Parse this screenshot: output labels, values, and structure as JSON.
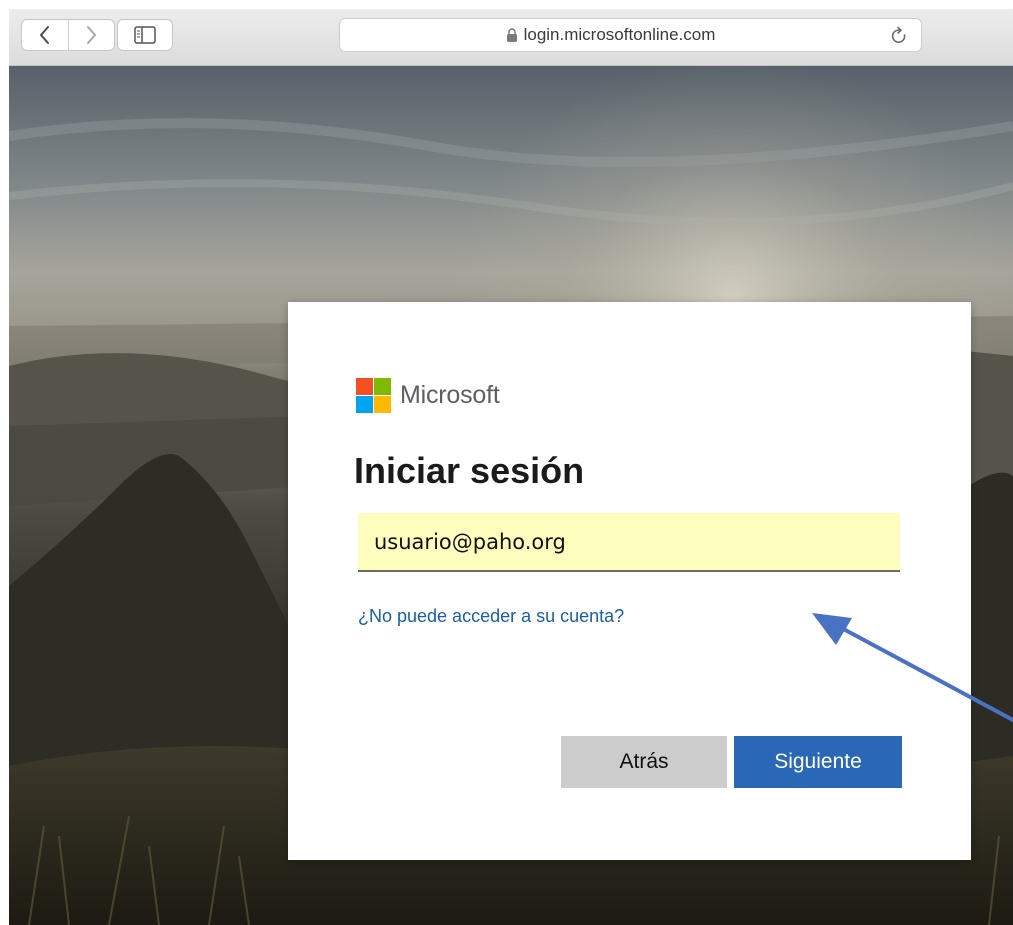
{
  "browser": {
    "url": "login.microsoftonline.com",
    "icons": {
      "back": "chevron-left-icon",
      "forward": "chevron-right-icon",
      "sidebar": "sidebar-icon",
      "lock": "lock-icon",
      "reload": "reload-icon"
    }
  },
  "login": {
    "brand_name": "Microsoft",
    "brand_colors": [
      "#f25022",
      "#7fba00",
      "#00a4ef",
      "#ffb900"
    ],
    "title": "Iniciar sesión",
    "email_value": "usuario@paho.org",
    "help_link": "¿No puede acceder a su cuenta?",
    "back_label": "Atrás",
    "next_label": "Siguiente"
  },
  "colors": {
    "link": "#1a5ea8",
    "primary_button": "#2a67b6",
    "secondary_button": "#cccccc",
    "input_autofill": "#fdfdbe",
    "annotation_arrow": "#4a72c4"
  }
}
